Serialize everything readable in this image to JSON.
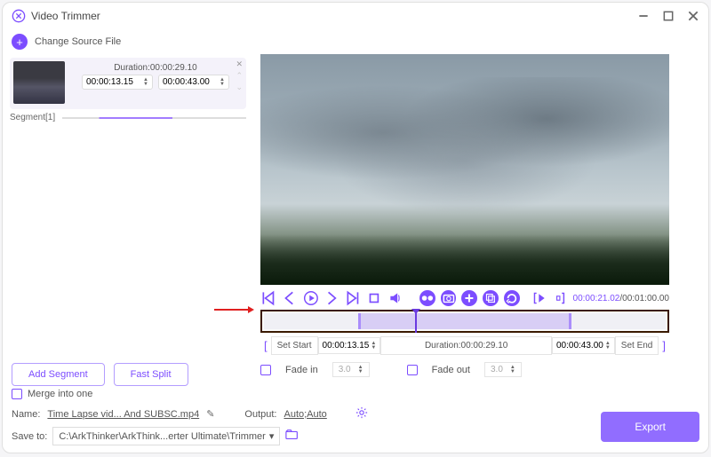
{
  "window": {
    "title": "Video Trimmer"
  },
  "toolbar": {
    "change_source": "Change Source File"
  },
  "segment": {
    "duration_label": "Duration:00:00:29.10",
    "start": "00:00:13.15",
    "end": "00:00:43.00",
    "label": "Segment[1]"
  },
  "buttons": {
    "add_segment": "Add Segment",
    "fast_split": "Fast Split",
    "export": "Export"
  },
  "preview": {
    "time_current": "00:00:21.02",
    "time_total": "/00:01:00.00"
  },
  "set": {
    "set_start": "Set Start",
    "start_val": "00:00:13.15",
    "duration": "Duration:00:00:29.10",
    "end_val": "00:00:43.00",
    "set_end": "Set End"
  },
  "fade": {
    "in_label": "Fade in",
    "in_val": "3.0",
    "out_label": "Fade out",
    "out_val": "3.0"
  },
  "merge": {
    "label": "Merge into one"
  },
  "meta": {
    "name_label": "Name:",
    "name_val": "Time Lapse vid... And SUBSC.mp4",
    "output_label": "Output:",
    "output_val": "Auto;Auto",
    "save_label": "Save to:",
    "save_path": "C:\\ArkThinker\\ArkThink...erter Ultimate\\Trimmer"
  }
}
